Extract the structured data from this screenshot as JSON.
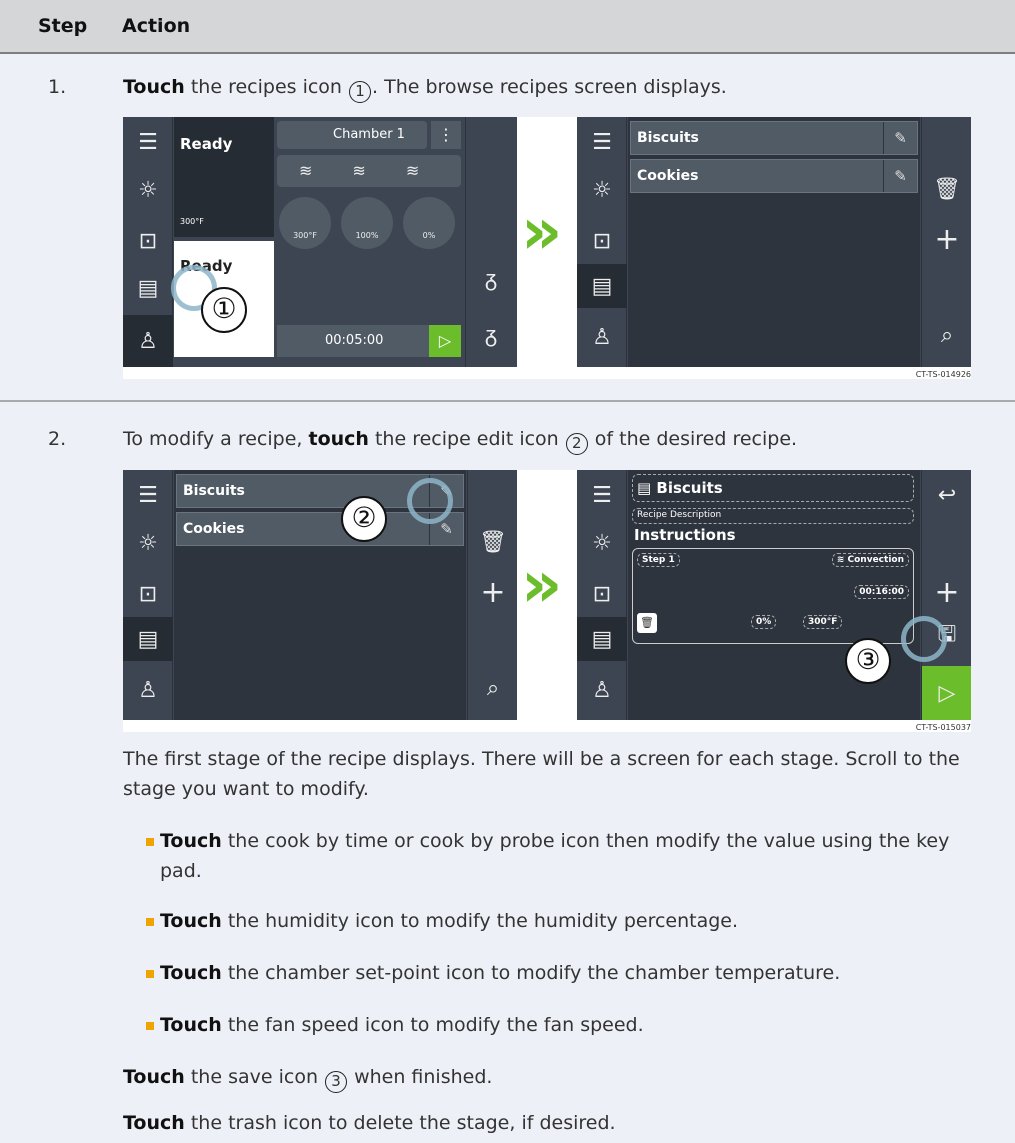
{
  "header": {
    "step": "Step",
    "action": "Action"
  },
  "steps": [
    {
      "num": "1.",
      "pre_bold": "Touch",
      "text_a": " the recipes icon ",
      "marker": "1",
      "text_b": ". The browse recipes screen displays.",
      "figure_id": "CT-TS-014926"
    },
    {
      "num": "2.",
      "text_pre": "To modify a recipe, ",
      "bold": "touch",
      "text_a": " the recipe edit icon ",
      "marker": "2",
      "text_b": " of the desired recipe.",
      "figure_id": "CT-TS-015037"
    }
  ],
  "after": {
    "para": "The first stage of the recipe displays. There will be a screen for each stage. Scroll to the stage you want to modify.",
    "bullets": [
      {
        "bold": "Touch",
        "text": " the cook by time or cook by probe icon then modify the value using the key pad."
      },
      {
        "bold": "Touch",
        "text": " the humidity icon to modify the humidity percentage."
      },
      {
        "bold": "Touch",
        "text": " the chamber set-point icon to modify the chamber temperature."
      },
      {
        "bold": "Touch",
        "text": " the fan speed icon to modify the fan speed."
      }
    ],
    "save": {
      "bold": "Touch",
      "text_a": " the save icon ",
      "marker": "3",
      "text_b": " when finished."
    },
    "trash": {
      "bold": "Touch",
      "text": " the trash icon to delete the stage, if desired."
    }
  },
  "screens": {
    "home": {
      "ready_top": "Ready",
      "temp": "300°F",
      "ready_bottom": "Ready",
      "chamber": "Chamber 1",
      "dial_temp": "300°F",
      "dial_fan": "100%",
      "dial_hum": "0%",
      "timer": "00:05:00"
    },
    "recipes": [
      "Biscuits",
      "Cookies"
    ],
    "edit": {
      "title": "Biscuits",
      "description": "Recipe Description",
      "instructions": "Instructions",
      "step": "Step 1",
      "mode": "Convection",
      "time": "00:16:00",
      "humidity": "0%",
      "temp": "300°F"
    }
  },
  "icons": [
    "menu-icon",
    "brightness-icon",
    "lock-icon",
    "recipes-icon",
    "user-icon",
    "edit-icon",
    "trash-icon",
    "plus-icon",
    "search-icon",
    "back-icon",
    "save-icon",
    "play-icon",
    "hand-icon",
    "double-chevron-icon"
  ],
  "colors": {
    "accent_green": "#6cbd2c",
    "bullet": "#f0a400",
    "header_bg": "#d5d6d8",
    "screen_bg": "#3c4551"
  }
}
